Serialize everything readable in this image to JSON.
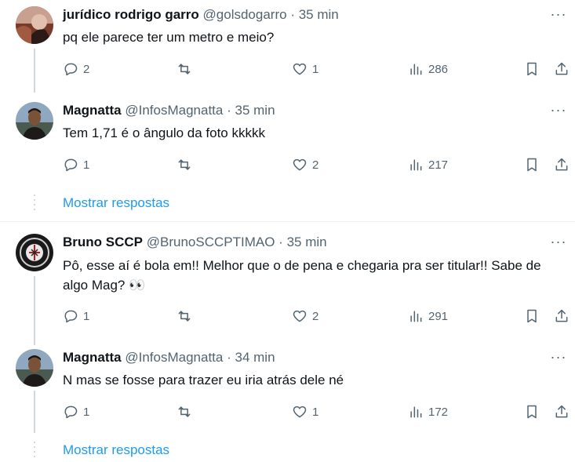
{
  "tweets": [
    {
      "name": "jurídico rodrigo garro",
      "handle": "@golsdogarro",
      "separator": "·",
      "time": "35 min",
      "text": "pq ele parece ter um metro e meio?",
      "replies": "2",
      "reposts": "",
      "likes": "1",
      "views": "286"
    },
    {
      "name": "Magnatta",
      "handle": "@InfosMagnatta",
      "separator": "·",
      "time": "35 min",
      "text": "Tem 1,71 é o ângulo da foto kkkkk",
      "replies": "1",
      "reposts": "",
      "likes": "2",
      "views": "217"
    },
    {
      "name": "Bruno SCCP",
      "handle": "@BrunoSCCPTIMAO",
      "separator": "·",
      "time": "35 min",
      "text": "Pô, esse aí é bola em!! Melhor que o de pena e chegaria pra ser titular!! Sabe de algo Mag? 👀",
      "replies": "1",
      "reposts": "",
      "likes": "2",
      "views": "291"
    },
    {
      "name": "Magnatta",
      "handle": "@InfosMagnatta",
      "separator": "·",
      "time": "34 min",
      "text": "N mas se fosse para trazer eu iria atrás dele né",
      "replies": "1",
      "reposts": "",
      "likes": "1",
      "views": "172"
    }
  ],
  "show_replies_label": "Mostrar respostas",
  "more_label": "···"
}
